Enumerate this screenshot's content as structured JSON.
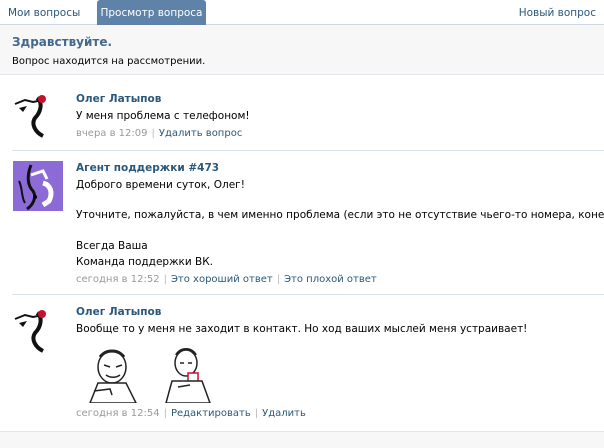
{
  "tabs": {
    "my_questions": "Мои вопросы",
    "view_question": "Просмотр вопроса",
    "new_question": "Новый вопрос"
  },
  "header": {
    "greeting": "Здравствуйте.",
    "status": "Вопрос находится на рассмотрении."
  },
  "messages": [
    {
      "author": "Олег Латыпов",
      "lines": [
        "У меня проблема с телефоном!"
      ],
      "time": "вчера в 12:09",
      "actions": [
        "Удалить вопрос"
      ]
    },
    {
      "author": "Агент поддержки #473",
      "lines": [
        "Доброго времени суток, Олег!",
        "Уточните, пожалуйста, в чем именно проблема (если это не отсутствие чьего-то номера, конечно).",
        "Всегда Ваша",
        "Команда поддержки ВК."
      ],
      "time": "сегодня в 12:52",
      "actions": [
        "Это хороший ответ",
        "Это плохой ответ"
      ]
    },
    {
      "author": "Олег Латыпов",
      "lines": [
        "Вообще то у меня не заходит в контакт. Но ход ваших мыслей меня устраивает!"
      ],
      "time": "сегодня в 12:54",
      "actions": [
        "Редактировать",
        "Удалить"
      ]
    }
  ],
  "colors": {
    "link": "#2b587a",
    "active_tab": "#5e82a8",
    "agent_avatar_bg": "#8c6bd6"
  }
}
